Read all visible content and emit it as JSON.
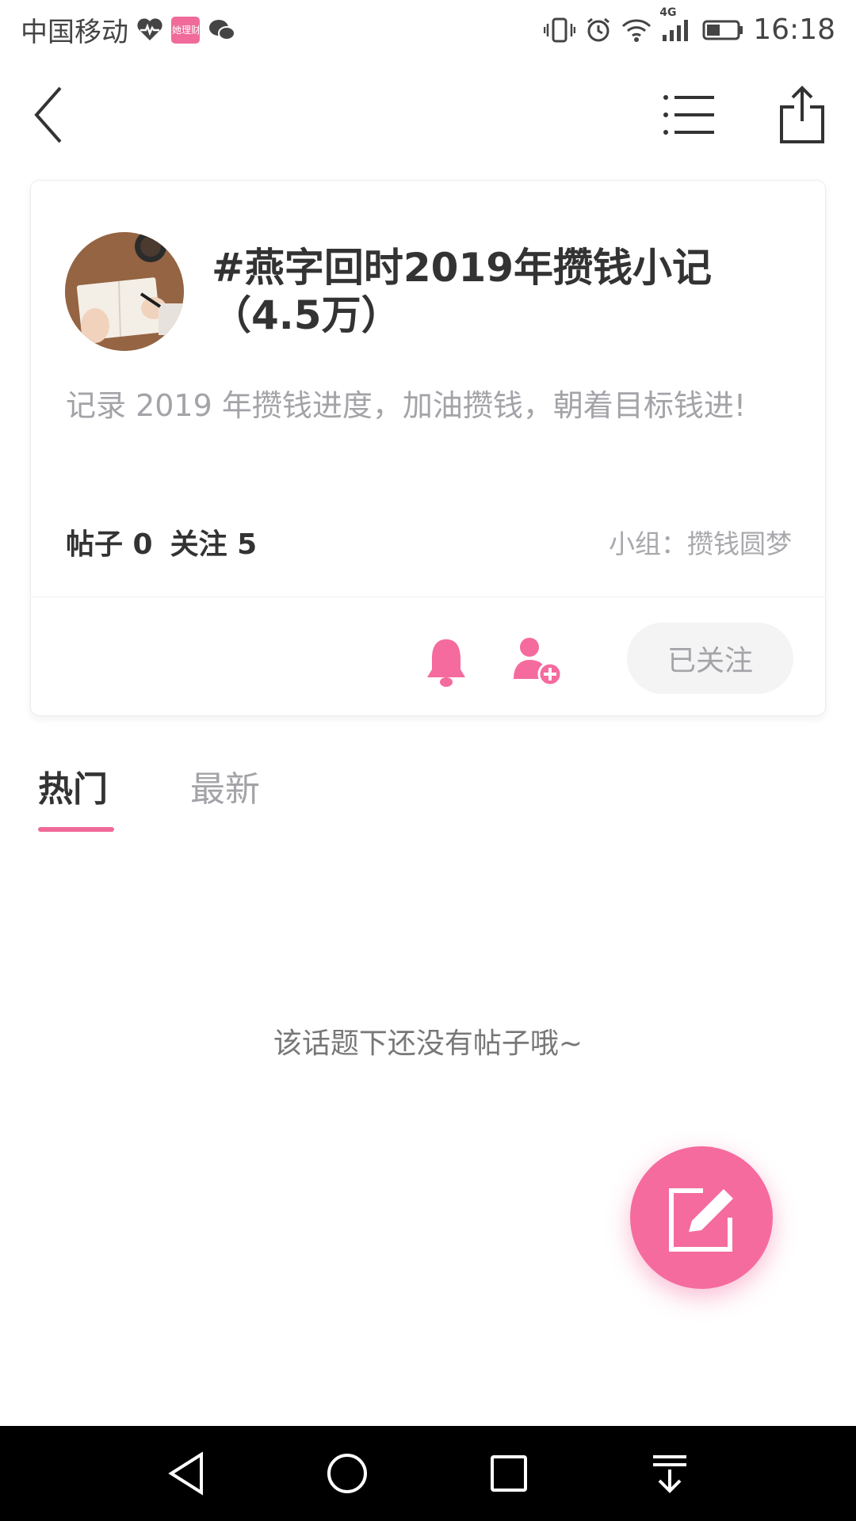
{
  "status_bar": {
    "carrier": "中国移动",
    "badge_text": "她理财",
    "network": "4G",
    "time": "16:18",
    "icons": [
      "heartbeat-icon",
      "app-badge-icon",
      "wechat-icon",
      "vibrate-icon",
      "alarm-icon",
      "wifi-icon",
      "signal-icon",
      "battery-icon"
    ]
  },
  "nav": {
    "icons": [
      "back-arrow-icon",
      "list-menu-icon",
      "share-icon"
    ]
  },
  "topic": {
    "title": "#燕字回时2019年攒钱小记（4.5万）",
    "description": "记录 2019 年攒钱进度，加油攒钱，朝着目标钱进!",
    "posts_label": "帖子 0",
    "follows_label": "关注 5",
    "group": "小组：攒钱圆梦",
    "follow_button": "已关注"
  },
  "tabs": [
    {
      "label": "热门",
      "active": true
    },
    {
      "label": "最新",
      "active": false
    }
  ],
  "empty_message": "该话题下还没有帖子哦~",
  "colors": {
    "accent": "#f56b9d",
    "title_text": "#333333",
    "muted_text": "#a3a3a8",
    "follow_button_bg": "#f4f4f5"
  }
}
